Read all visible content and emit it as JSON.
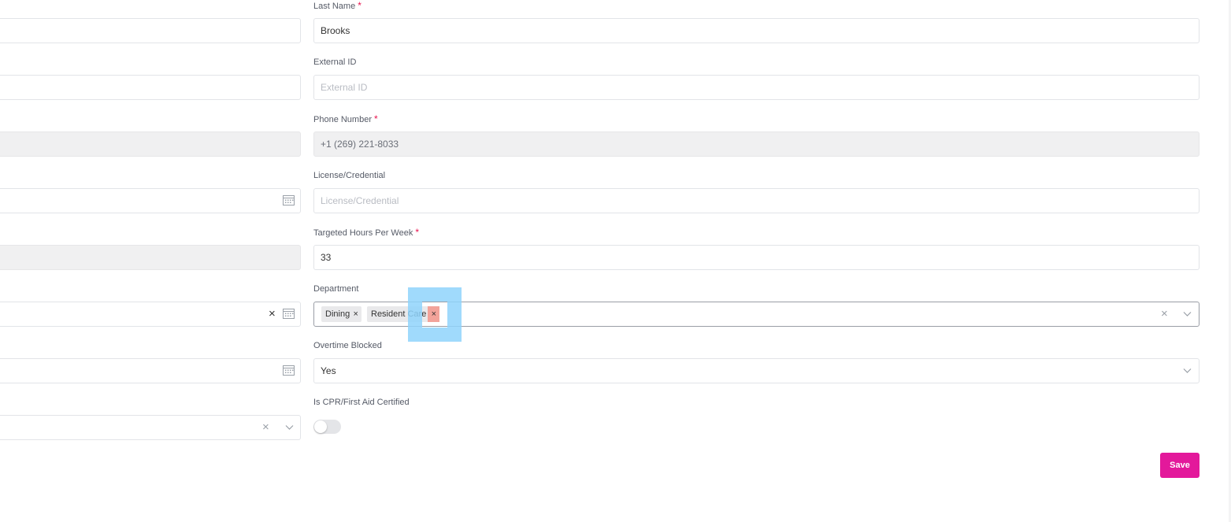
{
  "right_column": {
    "last_name": {
      "label": "Last Name",
      "required_mark": "*",
      "value": "Brooks"
    },
    "external_id": {
      "label": "External ID",
      "placeholder": "External ID"
    },
    "phone_number": {
      "label": "Phone Number",
      "required_mark": "*",
      "value": "+1 (269) 221-8033"
    },
    "license": {
      "label": "License/Credential",
      "placeholder": "License/Credential"
    },
    "targeted_hours": {
      "label": "Targeted Hours Per Week",
      "required_mark": "*",
      "value": "33"
    },
    "department": {
      "label": "Department",
      "tags": [
        {
          "label": "Dining",
          "remove": "×"
        },
        {
          "label": "Resident Care",
          "remove": "×"
        }
      ],
      "clear": "×"
    },
    "overtime_blocked": {
      "label": "Overtime Blocked",
      "value": "Yes"
    },
    "cpr_certified": {
      "label": "Is CPR/First Aid Certified",
      "on": false
    }
  },
  "left_column": {
    "date_clear": "×",
    "select_clear": "×"
  },
  "actions": {
    "save_label": "Save"
  },
  "colors": {
    "accent": "#e3199b",
    "required": "#e8114d",
    "highlight": "#8fd3fb",
    "tag_remove_hover": "#f2a39a"
  }
}
